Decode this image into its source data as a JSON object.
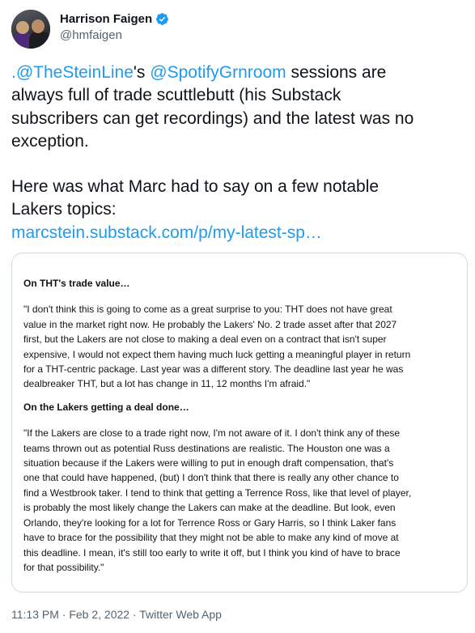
{
  "author": {
    "display_name": "Harrison Faigen",
    "handle": "@hmfaigen",
    "verified": true,
    "verified_icon": "verified-badge-icon"
  },
  "tweet": {
    "mention1": ".@TheSteinLine",
    "text1": "'s ",
    "mention2": "@SpotifyGrnroom",
    "text2": " sessions are",
    "line2": "always full of trade scuttlebutt (his Substack",
    "line3": "subscribers can get recordings) and the latest was no",
    "line4": "exception.",
    "line5": "Here was what Marc had to say on a few notable",
    "line6": "Lakers topics:",
    "link": "marcstein.substack.com/p/my-latest-sp…"
  },
  "card": {
    "heading1": "On THT's trade value…",
    "quote1": [
      "\"I don't think this is going to come as a great surprise to you: THT does not have great",
      "value in the market right now. He probably the Lakers' No. 2 trade asset after that 2027",
      "first, but the Lakers are not close to making a deal even on a contract that isn't super",
      "expensive, I would not expect them having much luck getting a meaningful player in return",
      "for a THT-centric package. Last year was a different story. The deadline last year he was",
      "dealbreaker THT, but a lot has change in 11, 12 months I'm afraid.\""
    ],
    "heading2": "On the Lakers getting a deal done…",
    "quote2": [
      "\"If the Lakers are close to a trade right now, I'm not aware of it. I don't think any of these",
      "teams thrown out as potential Russ destinations are realistic. The Houston one was a",
      "situation because if the Lakers were willing to put in enough draft compensation, that's",
      "one that could have happened, (but) I don't think that there is really any other chance to",
      "find a Westbrook taker. I tend to think that getting a Terrence Ross, like that level of player,",
      "is probably the most likely change the Lakers can make at the deadline. But look, even",
      "Orlando, they're looking for a lot for Terrence Ross or Gary Harris, so I think Laker fans",
      "have to brace for the possibility that they might not be able to make any kind of move at",
      "this deadline. I mean, it's still too early to write it off, but I think you kind of have to brace",
      "for that possibility.\""
    ]
  },
  "meta": {
    "timestamp": "11:13 PM · Feb 2, 2022 · Twitter Web App"
  },
  "colors": {
    "link": "#1d9bf0",
    "secondary_text": "#536471",
    "primary_text": "#0f1419",
    "border": "#cfd9de"
  }
}
